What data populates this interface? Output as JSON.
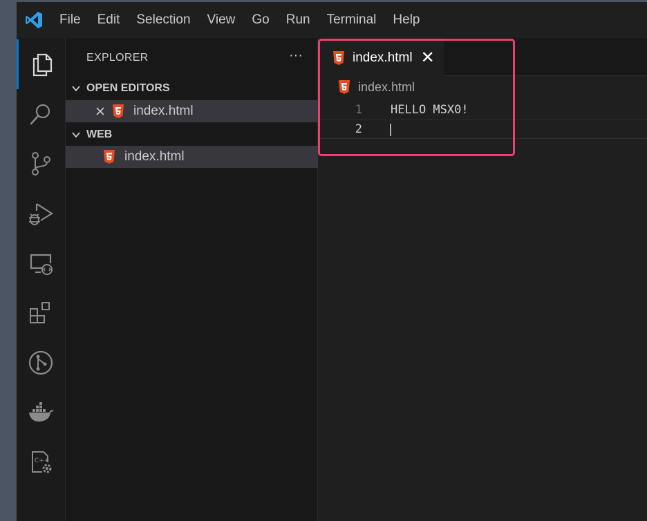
{
  "menu": [
    "File",
    "Edit",
    "Selection",
    "View",
    "Go",
    "Run",
    "Terminal",
    "Help"
  ],
  "activity_bar": [
    {
      "icon": "files-icon",
      "active": true
    },
    {
      "icon": "search-icon"
    },
    {
      "icon": "source-control-icon"
    },
    {
      "icon": "run-debug-icon"
    },
    {
      "icon": "remote-explorer-icon"
    },
    {
      "icon": "extensions-icon"
    },
    {
      "icon": "git-graph-icon"
    },
    {
      "icon": "docker-icon"
    },
    {
      "icon": "cpp-settings-icon"
    }
  ],
  "explorer": {
    "title": "EXPLORER",
    "more": "···",
    "open_editors": {
      "header": "OPEN EDITORS",
      "items": [
        {
          "label": "index.html"
        }
      ]
    },
    "workspace": {
      "header": "WEB",
      "items": [
        {
          "label": "index.html"
        }
      ]
    }
  },
  "editor": {
    "tab": {
      "label": "index.html",
      "close": "✕"
    },
    "breadcrumb": "index.html",
    "lines": [
      {
        "number": "1",
        "text": "HELLO MSX0!"
      },
      {
        "number": "2",
        "text": ""
      }
    ]
  },
  "colors": {
    "accent": "#007acc",
    "html_icon": "#e44d26",
    "highlight": "#ec3f6e"
  }
}
